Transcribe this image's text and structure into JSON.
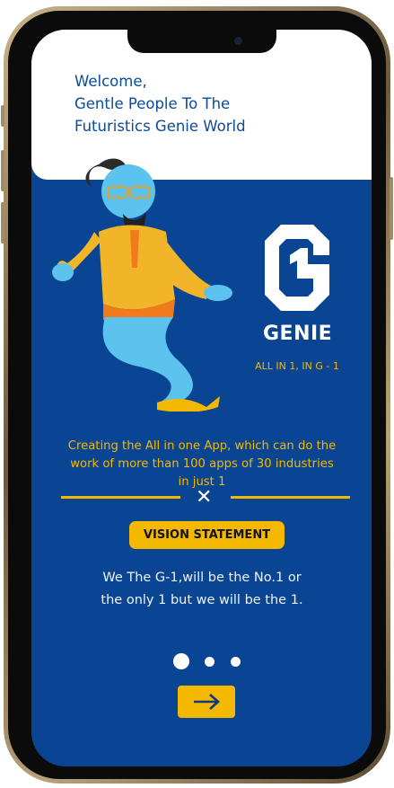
{
  "header": {
    "welcome_lines": [
      "Welcome,",
      "Gentle People To The",
      "Futuristics Genie World"
    ]
  },
  "brand": {
    "name": "GENIE",
    "tagline": "ALL IN 1, IN G - 1"
  },
  "intro": {
    "text": "Creating the All in one App, which can do the work of more than 100 apps of 30 industries in just 1"
  },
  "vision": {
    "label": "VISION STATEMENT",
    "text_lines": [
      "We The G-1,will be the No.1 or",
      "the only 1 but we will be the 1."
    ]
  },
  "pager": {
    "count": 3,
    "active": 1
  },
  "colors": {
    "primary": "#0a4593",
    "accent": "#f5b800"
  }
}
